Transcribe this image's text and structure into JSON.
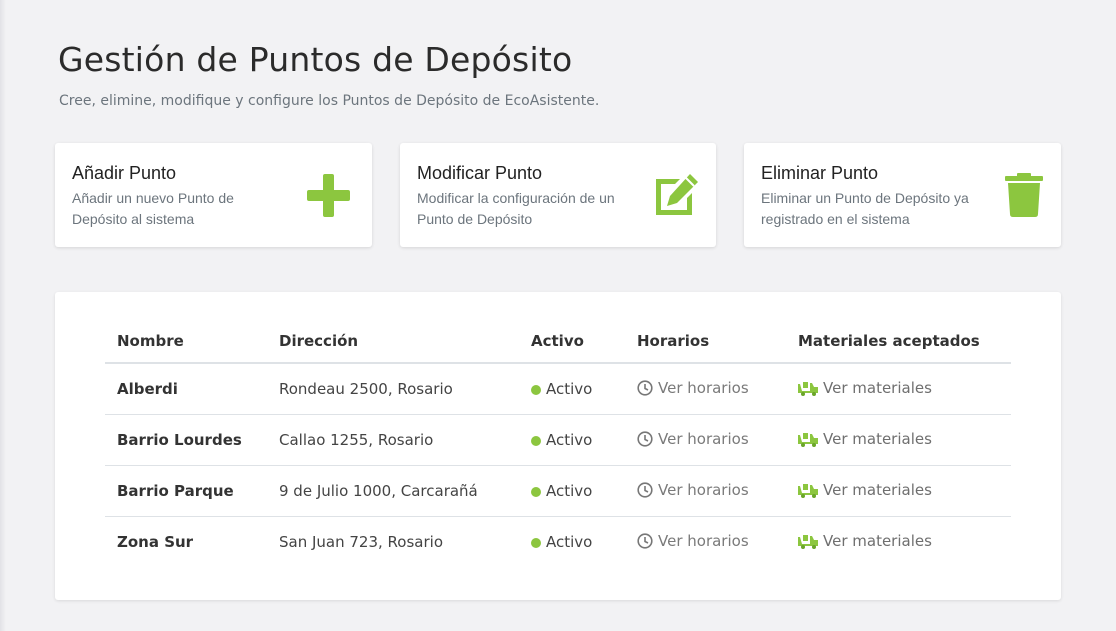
{
  "header": {
    "title": "Gestión de Puntos de Depósito",
    "subtitle": "Cree, elimine, modifique y configure los Puntos de Depósito de EcoAsistente."
  },
  "colors": {
    "accent": "#8cc63f",
    "status_active": "#8cc63f"
  },
  "actions": [
    {
      "title": "Añadir Punto",
      "description": "Añadir un nuevo Punto de Depósito al sistema",
      "icon": "plus-icon"
    },
    {
      "title": "Modificar Punto",
      "description": "Modificar la configuración de un Punto de Depósito",
      "icon": "edit-icon"
    },
    {
      "title": "Eliminar Punto",
      "description": "Eliminar un Punto de Depósito ya registrado en el sistema",
      "icon": "trash-icon"
    }
  ],
  "table": {
    "columns": [
      "Nombre",
      "Dirección",
      "Activo",
      "Horarios",
      "Materiales aceptados"
    ],
    "rows": [
      {
        "name": "Alberdi",
        "address": "Rondeau 2500, Rosario",
        "status": "Activo",
        "schedule": "Ver horarios",
        "materials": "Ver materiales"
      },
      {
        "name": "Barrio Lourdes",
        "address": "Callao 1255, Rosario",
        "status": "Activo",
        "schedule": "Ver horarios",
        "materials": "Ver materiales"
      },
      {
        "name": "Barrio Parque",
        "address": "9 de Julio 1000, Carcarañá",
        "status": "Activo",
        "schedule": "Ver horarios",
        "materials": "Ver materiales"
      },
      {
        "name": "Zona Sur",
        "address": "San Juan 723, Rosario",
        "status": "Activo",
        "schedule": "Ver horarios",
        "materials": "Ver materiales"
      }
    ]
  }
}
